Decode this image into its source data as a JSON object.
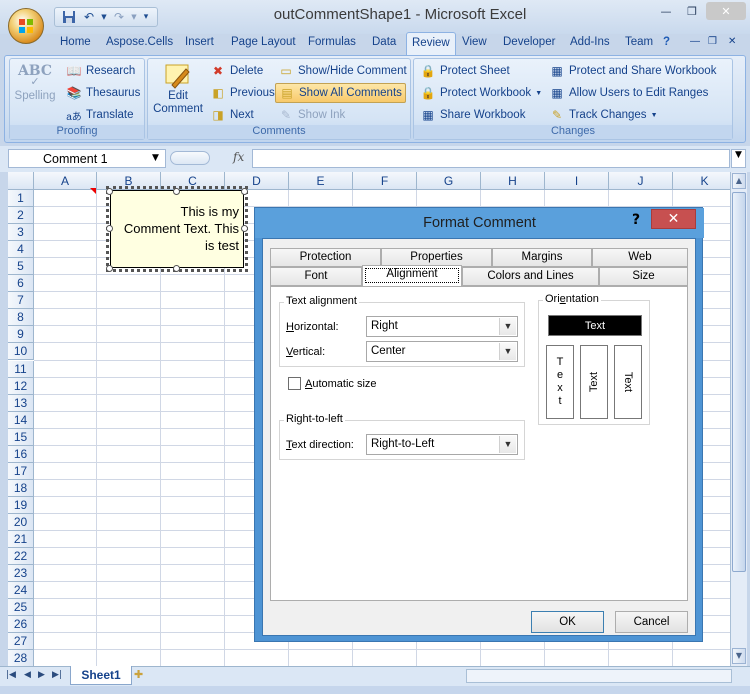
{
  "app": {
    "title": "outCommentShape1 - Microsoft Excel"
  },
  "quick_access": {
    "icons": [
      "save-icon",
      "undo-icon",
      "redo-icon",
      "customize-icon"
    ]
  },
  "ribbon_tabs": [
    "Home",
    "Aspose.Cells",
    "Insert",
    "Page Layout",
    "Formulas",
    "Data",
    "Review",
    "View",
    "Developer",
    "Add-Ins",
    "Team"
  ],
  "active_tab": "Review",
  "ribbon": {
    "proofing": {
      "label": "Proofing",
      "spelling": "Spelling",
      "research": "Research",
      "thesaurus": "Thesaurus",
      "translate": "Translate"
    },
    "comments": {
      "label": "Comments",
      "edit_comment_line1": "Edit",
      "edit_comment_line2": "Comment",
      "delete": "Delete",
      "previous": "Previous",
      "next": "Next",
      "show_hide": "Show/Hide Comment",
      "show_all": "Show All Comments",
      "show_ink": "Show Ink"
    },
    "changes": {
      "label": "Changes",
      "protect_sheet": "Protect Sheet",
      "protect_workbook": "Protect Workbook",
      "share_workbook": "Share Workbook",
      "protect_share": "Protect and Share Workbook",
      "allow_users": "Allow Users to Edit Ranges",
      "track_changes": "Track Changes"
    }
  },
  "formula_bar": {
    "name_box": "Comment 1",
    "fx": "fx",
    "formula": ""
  },
  "columns": [
    "A",
    "B",
    "C",
    "D",
    "E",
    "F",
    "G",
    "H",
    "I",
    "J",
    "K"
  ],
  "rows": [
    "1",
    "2",
    "3",
    "4",
    "5",
    "6",
    "7",
    "8",
    "9",
    "10",
    "11",
    "12",
    "13",
    "14",
    "15",
    "16",
    "17",
    "18",
    "19",
    "20",
    "21",
    "22",
    "23",
    "24",
    "25",
    "26",
    "27",
    "28"
  ],
  "comment": {
    "line1": "This is my",
    "line2": "Comment Text. This",
    "line3": "is test"
  },
  "sheets": {
    "active": "Sheet1"
  },
  "dialog": {
    "title": "Format Comment",
    "help": "?",
    "close": "✕",
    "tabs_row1": [
      "Protection",
      "Properties",
      "Margins",
      "Web"
    ],
    "tabs_row2": [
      "Font",
      "Alignment",
      "Colors and Lines",
      "Size"
    ],
    "active_tab": "Alignment",
    "text_alignment": {
      "legend": "Text alignment",
      "horizontal_label_u": "H",
      "horizontal_label_rest": "orizontal:",
      "horizontal_value": "Right",
      "vertical_label_u": "V",
      "vertical_label_rest": "ertical:",
      "vertical_value": "Center",
      "auto_size_u": "A",
      "auto_size_rest": "utomatic size",
      "auto_size_checked": false
    },
    "orientation": {
      "legend_pre": "Ori",
      "legend_u": "e",
      "legend_post": "ntation",
      "horizontal_text": "Text",
      "stacked_letters": [
        "T",
        "e",
        "x",
        "t"
      ],
      "rotated_up": "Text",
      "rotated_down": "Text"
    },
    "rtl": {
      "legend": "Right-to-left",
      "direction_label_u": "T",
      "direction_label_rest": "ext direction:",
      "direction_value": "Right-to-Left"
    },
    "ok": "OK",
    "cancel": "Cancel"
  }
}
